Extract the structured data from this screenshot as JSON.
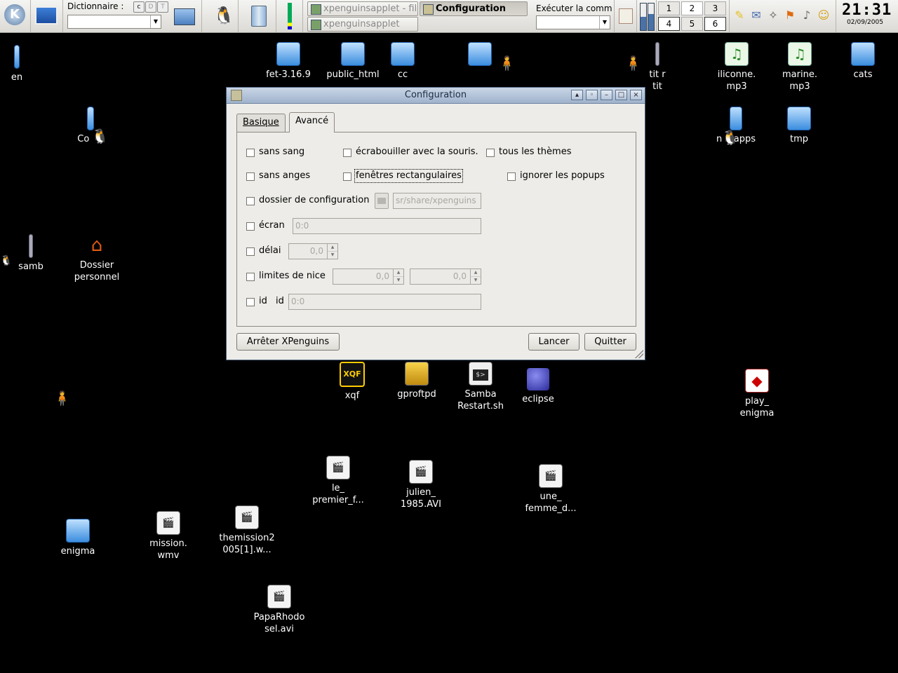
{
  "taskbar": {
    "dictionary_label": "Dictionnaire :",
    "dictionary_buttons": [
      "c",
      "D",
      "T"
    ],
    "tasks": [
      {
        "label": "xpenguinsapplet - fil"
      },
      {
        "label": "xpenguinsapplet"
      },
      {
        "label": "Configuration"
      }
    ],
    "run_label": "Exécuter la comm",
    "pager": [
      "1",
      "2",
      "3",
      "4",
      "5",
      "6"
    ],
    "clock_time": "21:31",
    "clock_date": "02/09/2005"
  },
  "dialog": {
    "title": "Configuration",
    "window_buttons": [
      "▴",
      "◦",
      "–",
      "□",
      "×"
    ],
    "tabs": {
      "basic": "Basique",
      "advanced": "Avancé"
    },
    "options": {
      "sans_sang": "sans sang",
      "ecrabouiller": "écrabouiller avec la souris.",
      "tous_themes": "tous les thèmes",
      "sans_anges": "sans anges",
      "fenetres_rect": "fenêtres rectangulaires",
      "ignorer_popups": "ignorer les popups",
      "dossier_config": "dossier de configuration",
      "ecran": "écran",
      "delai": "délai",
      "limites_nice": "limites de nice",
      "id": "id",
      "id_sub": "id"
    },
    "fields": {
      "config_dir": "sr/share/xpenguins",
      "ecran": "0:0",
      "delai": "0,0",
      "nice_min": "0,0",
      "nice_max": "0,0",
      "id": "0:0"
    },
    "buttons": {
      "stop": "Arrêter XPenguins",
      "launch": "Lancer",
      "quit": "Quitter"
    }
  },
  "desktop": {
    "icons": [
      {
        "label": "en",
        "glyph": "folder-icon"
      },
      {
        "label": "fet-3.16.9",
        "glyph": "folder-icon"
      },
      {
        "label": "public_html",
        "glyph": "folder-icon"
      },
      {
        "label": "cc",
        "glyph": "folder-icon"
      },
      {
        "label": "",
        "glyph": "folder-icon"
      },
      {
        "label": "tit r\ntit",
        "glyph": "misc-icon"
      },
      {
        "label": "iliconne.\nmp3",
        "glyph": "music-icon"
      },
      {
        "label": "marine.\nmp3",
        "glyph": "music-icon"
      },
      {
        "label": "cats",
        "glyph": "folder-icon"
      },
      {
        "label": "Co   e",
        "glyph": "misc-icon"
      },
      {
        "label": "n    apps",
        "glyph": "misc-icon"
      },
      {
        "label": "tmp",
        "glyph": "folder-icon"
      },
      {
        "label": "samb",
        "glyph": "misc-icon"
      },
      {
        "label": "Dossier\npersonnel",
        "glyph": "home-icon"
      },
      {
        "label": "xqf",
        "glyph": "xqf-icon"
      },
      {
        "label": "gproftpd",
        "glyph": "misc-icon"
      },
      {
        "label": "Samba\nRestart.sh",
        "glyph": "terminal-icon"
      },
      {
        "label": "eclipse",
        "glyph": "eclipse-icon"
      },
      {
        "label": "play_\nenigma",
        "glyph": "enigma-icon"
      },
      {
        "label": "le_\npremier_f...",
        "glyph": "video-icon"
      },
      {
        "label": "julien_\n1985.AVI",
        "glyph": "video-icon"
      },
      {
        "label": "une_\nfemme_d...",
        "glyph": "video-icon"
      },
      {
        "label": "enigma",
        "glyph": "folder-icon"
      },
      {
        "label": "mission.\nwmv",
        "glyph": "video-icon"
      },
      {
        "label": "themission2\n005[1].w...",
        "glyph": "video-icon"
      },
      {
        "label": "PapaRhodo\nsel.avi",
        "glyph": "video-icon"
      }
    ]
  }
}
